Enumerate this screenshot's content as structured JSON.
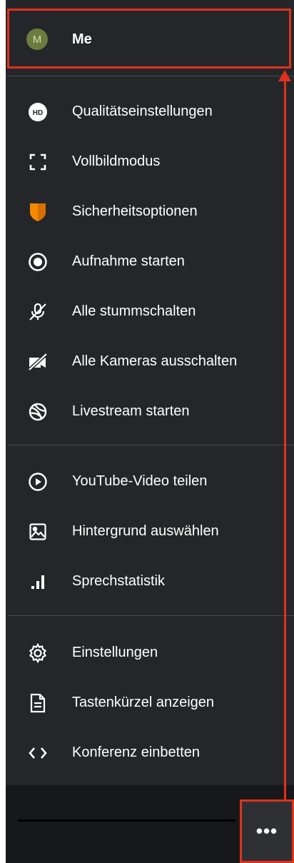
{
  "user": {
    "avatar_letter": "M",
    "name": "Me"
  },
  "groups": [
    [
      {
        "id": "quality",
        "label": "Qualitätseinstellungen",
        "icon": "hd-icon"
      },
      {
        "id": "fullscreen",
        "label": "Vollbildmodus",
        "icon": "fullscreen-icon"
      },
      {
        "id": "security",
        "label": "Sicherheitsoptionen",
        "icon": "shield-icon"
      },
      {
        "id": "record",
        "label": "Aufnahme starten",
        "icon": "record-icon"
      },
      {
        "id": "mute-all",
        "label": "Alle stummschalten",
        "icon": "mic-off-icon"
      },
      {
        "id": "cams-off",
        "label": "Alle Kameras ausschalten",
        "icon": "camera-off-icon"
      },
      {
        "id": "livestream",
        "label": "Livestream starten",
        "icon": "globe-icon"
      }
    ],
    [
      {
        "id": "youtube",
        "label": "YouTube-Video teilen",
        "icon": "play-circle-icon"
      },
      {
        "id": "background",
        "label": "Hintergrund auswählen",
        "icon": "image-icon"
      },
      {
        "id": "speaker-stats",
        "label": "Sprechstatistik",
        "icon": "bar-chart-icon"
      }
    ],
    [
      {
        "id": "settings",
        "label": "Einstellungen",
        "icon": "gear-icon"
      },
      {
        "id": "shortcuts",
        "label": "Tastenkürzel anzeigen",
        "icon": "document-icon"
      },
      {
        "id": "embed",
        "label": "Konferenz einbetten",
        "icon": "code-icon"
      }
    ]
  ],
  "more_button": {
    "label": "•••"
  },
  "colors": {
    "menu_bg": "#252629",
    "highlight": "#e0311c",
    "shield": "#f18a00",
    "avatar": "#6b7d3e"
  }
}
